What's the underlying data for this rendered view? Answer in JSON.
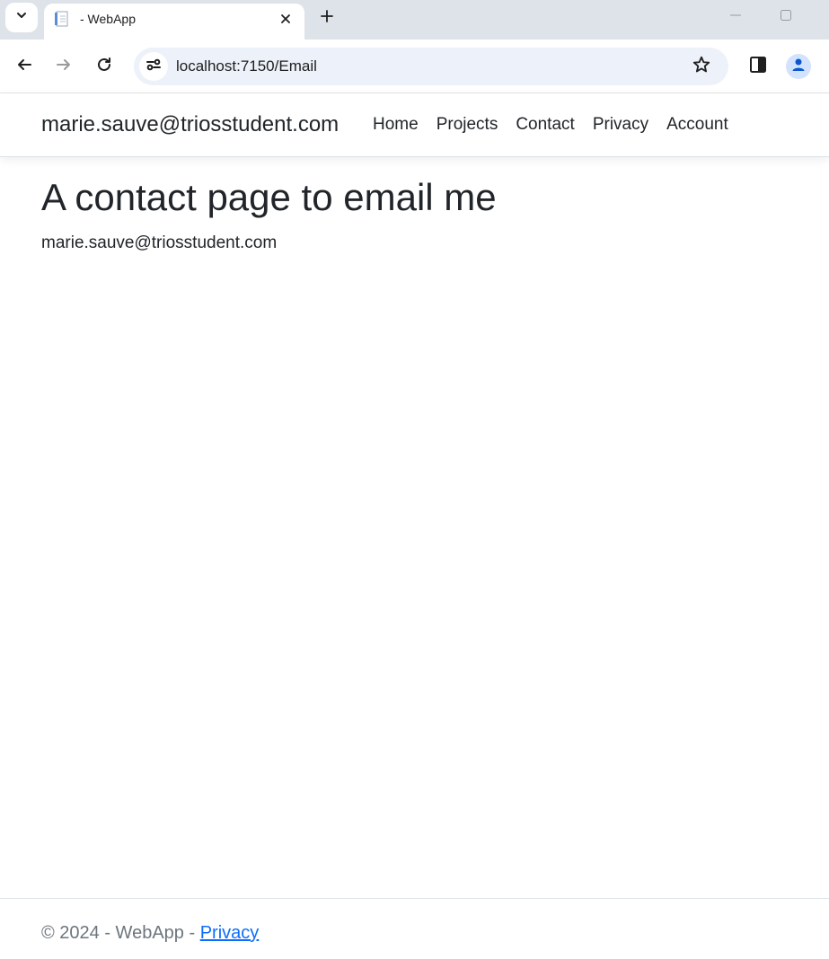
{
  "browser": {
    "tab": {
      "title": "- WebApp",
      "favicon": "document-icon"
    },
    "address_bar": {
      "url": "localhost:7150/Email"
    }
  },
  "navbar": {
    "brand": "marie.sauve@triosstudent.com",
    "links": [
      {
        "label": "Home"
      },
      {
        "label": "Projects"
      },
      {
        "label": "Contact"
      },
      {
        "label": "Privacy"
      },
      {
        "label": "Account"
      }
    ]
  },
  "main": {
    "heading": "A contact page to email me",
    "email": "marie.sauve@triosstudent.com"
  },
  "footer": {
    "copyright": "© 2024 - WebApp - ",
    "privacy_link": "Privacy"
  },
  "colors": {
    "link": "#0d6efd",
    "text": "#212529",
    "muted": "#6c757d",
    "tabstrip": "#dee3ea",
    "omnibox": "#edf1f9"
  }
}
